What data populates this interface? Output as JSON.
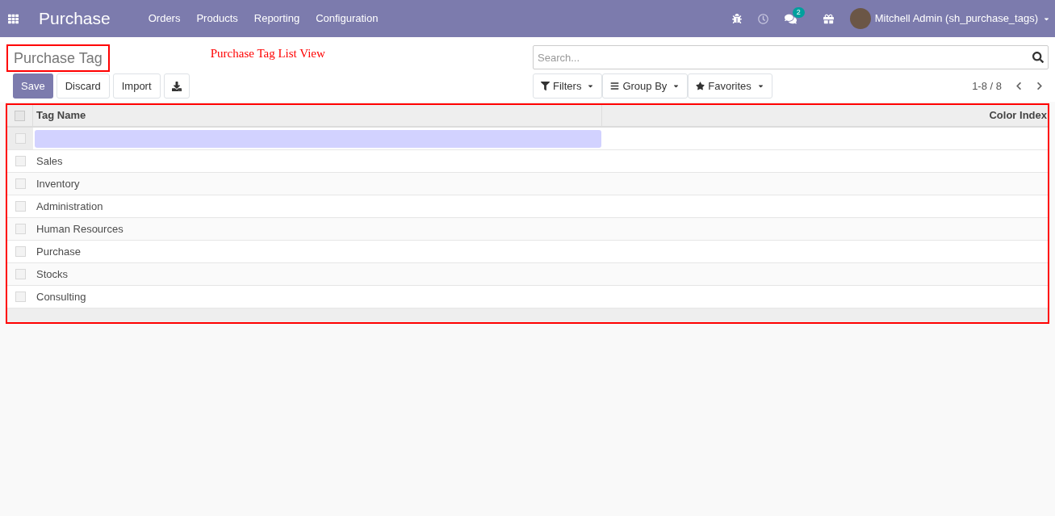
{
  "navbar": {
    "app_name": "Purchase",
    "menu": [
      "Orders",
      "Products",
      "Reporting",
      "Configuration"
    ],
    "messages_count": "2",
    "user": "Mitchell Admin (sh_purchase_tags)"
  },
  "control_panel": {
    "title": "Purchase Tag",
    "annotation": "Purchase Tag List View",
    "buttons": [
      {
        "label": "Save",
        "kind": "primary"
      },
      {
        "label": "Discard",
        "kind": "secondary"
      },
      {
        "label": "Import",
        "kind": "secondary"
      }
    ],
    "search": {
      "placeholder": "Search..."
    },
    "filters": [
      "Filters",
      "Group By",
      "Favorites"
    ],
    "pager": "1-8 / 8"
  },
  "table": {
    "columns": [
      "Tag Name",
      "Color Index"
    ],
    "header_checked": false,
    "rows": [
      {
        "kind": "editing",
        "checked": false
      },
      {
        "kind": "record",
        "name": "Sales",
        "checked": false
      },
      {
        "kind": "record",
        "name": "Inventory",
        "checked": false
      },
      {
        "kind": "record",
        "name": "Administration",
        "checked": false
      },
      {
        "kind": "record",
        "name": "Human Resources",
        "checked": false
      },
      {
        "kind": "record",
        "name": "Purchase",
        "checked": false
      },
      {
        "kind": "record",
        "name": "Stocks",
        "checked": false
      },
      {
        "kind": "record",
        "name": "Consulting",
        "checked": false
      }
    ]
  }
}
